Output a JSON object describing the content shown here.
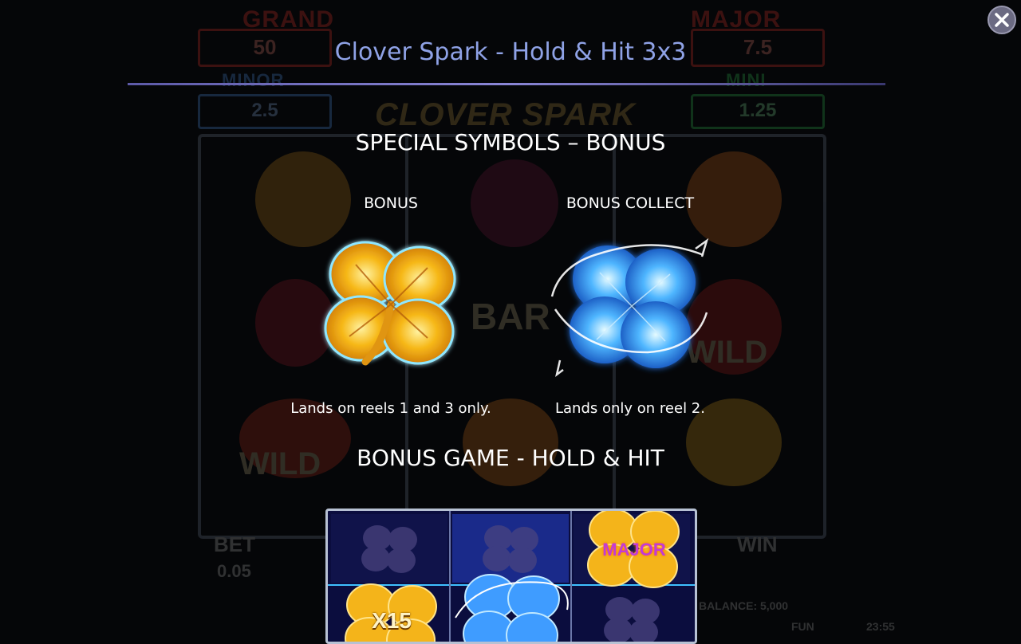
{
  "game_background": {
    "jackpots": [
      {
        "name": "GRAND",
        "value": "50"
      },
      {
        "name": "MAJOR",
        "value": "7.5"
      },
      {
        "name": "MINOR",
        "value": "2.5"
      },
      {
        "name": "MINI",
        "value": "1.25"
      }
    ],
    "logo_text": "CLOVER SPARK",
    "bet_label": "BET",
    "bet_value": "0.05",
    "win_label": "WIN",
    "balance_text": "BALANCE: 5,000",
    "mode_text": "FUN",
    "clock": "23:55",
    "wild_label": "WILD",
    "bar_label": "BAR"
  },
  "modal": {
    "title": "Clover Spark - Hold & Hit 3x3",
    "close_icon": "close-icon",
    "section_special": "SPECIAL SYMBOLS – BONUS",
    "symbols": [
      {
        "label": "BONUS",
        "icon": "gold-clover-icon",
        "description": "Lands on reels 1 and 3 only."
      },
      {
        "label": "BONUS COLLECT",
        "icon": "electric-blue-clover-icon",
        "description": "Lands only on reel 2."
      }
    ],
    "section_bonus_game": "BONUS GAME - HOLD & HIT",
    "example_grid": {
      "major_label": "MAJOR",
      "multiplier_label": "X15"
    }
  },
  "colors": {
    "title": "#8fa2e6",
    "gold": "#f4b41a",
    "electric_blue": "#4fb6ff",
    "grid_bg": "#0b0d3e"
  }
}
